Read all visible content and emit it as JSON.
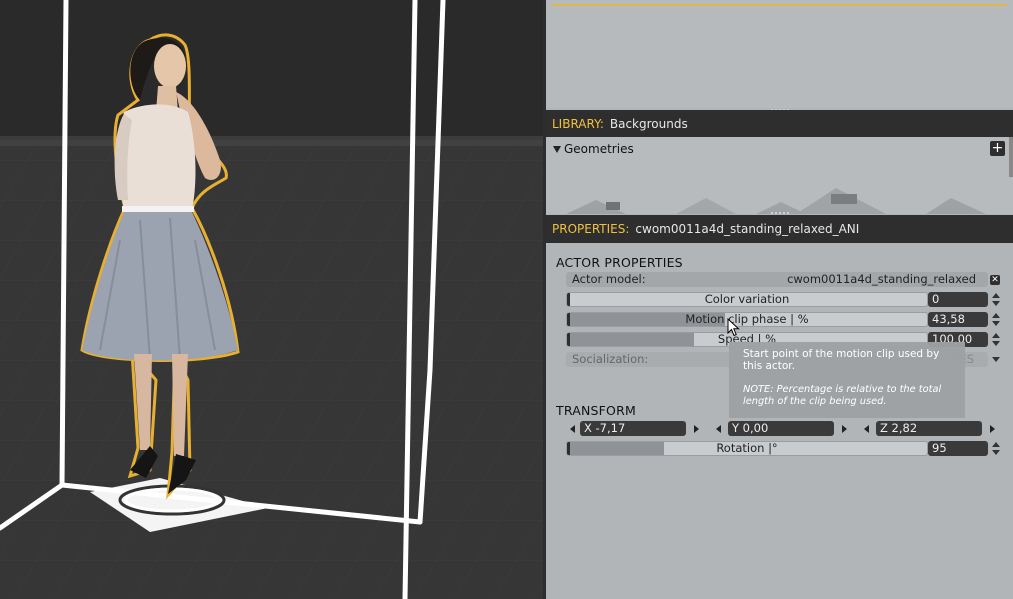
{
  "library": {
    "label": "LIBRARY:",
    "value": "Backgrounds",
    "group": "Geometries"
  },
  "properties": {
    "label": "PROPERTIES:",
    "value": "cwom0011a4d_standing_relaxed_ANI"
  },
  "actor": {
    "section_title": "ACTOR PROPERTIES",
    "model_label": "Actor model:",
    "model_value": "cwom0011a4d_standing_relaxed",
    "color_variation": {
      "label": "Color variation",
      "value": "0",
      "fraction": 0.0
    },
    "motion_clip_phase": {
      "label": "Motion clip phase | %",
      "value": "43,58",
      "fraction": 0.4358
    },
    "speed": {
      "label": "Speed | %",
      "value": "100,00",
      "fraction": 0.35
    },
    "socialization": {
      "label": "Socialization:",
      "value": "YES"
    }
  },
  "transform": {
    "section_title": "TRANSFORM",
    "x": "X  -7,17",
    "y": "Y  0,00",
    "z": "Z  2,82",
    "rotation": {
      "label": "Rotation |°",
      "value": "95",
      "fraction": 0.27
    }
  },
  "tooltip": {
    "text": "Start point of the motion clip used by this actor.",
    "note": "NOTE: Percentage is relative to the total length of the clip being used."
  },
  "colors": {
    "accent": "#f0c040",
    "outline": "#e8b030",
    "panel": "#b1b5b8",
    "header": "#2e2e2e"
  }
}
